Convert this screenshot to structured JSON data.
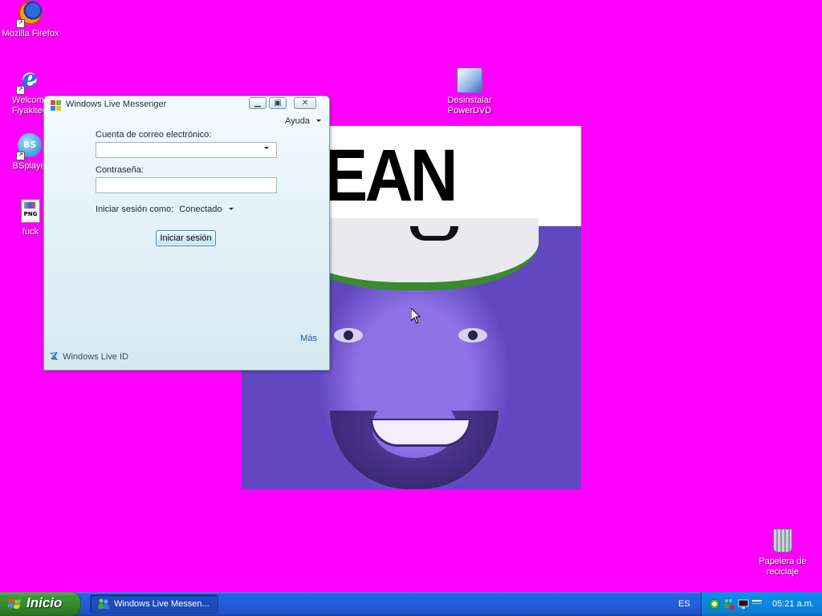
{
  "desktop": {
    "background_color": "#ff00ff",
    "icons": [
      {
        "id": "firefox",
        "label": "Mozilla Firefox",
        "icon": "firefox-icon"
      },
      {
        "id": "welcome",
        "label": "Welcome FlyakiteOSX",
        "label_visible": "Welcome\nFlyakiteO",
        "icon": "internet-explorer-icon"
      },
      {
        "id": "bsplayer",
        "label": "BSplayer",
        "icon": "bsplayer-icon"
      },
      {
        "id": "fuck",
        "label": "fuck",
        "icon": "png-file-icon"
      },
      {
        "id": "powerdvd",
        "label": "Desinstalar PowerDVD",
        "icon": "powerdvd-uninstall-icon"
      },
      {
        "id": "recycle",
        "label": "Papelera de reciclaje",
        "icon": "recycle-bin-icon"
      }
    ],
    "image_caption": "LEAN"
  },
  "messenger": {
    "title": "Windows Live Messenger",
    "help_menu": "Ayuda",
    "email_label": "Cuenta de correo electrónico:",
    "email_value": "",
    "password_label": "Contraseña:",
    "password_value": "",
    "status_label": "Iniciar sesión como:",
    "status_value": "Conectado",
    "signin_button": "Iniciar sesión",
    "more_link": "Más",
    "footer": "Windows Live ID",
    "controls": {
      "minimize": "minimize-icon",
      "restore": "restore-icon",
      "close": "close-icon"
    }
  },
  "taskbar": {
    "start_label": "Inicio",
    "tasks": [
      {
        "label": "Windows Live Messen...",
        "icon": "messenger-icon",
        "active": true
      }
    ],
    "language": "ES",
    "tray_icons": [
      "green-status-icon",
      "messenger-offline-icon",
      "display-icon",
      "network-icon"
    ],
    "clock": "05:21 a.m.",
    "colors": {
      "taskbar": "#245edb",
      "start": "#3c963a",
      "tray": "#0b7fd8"
    }
  }
}
